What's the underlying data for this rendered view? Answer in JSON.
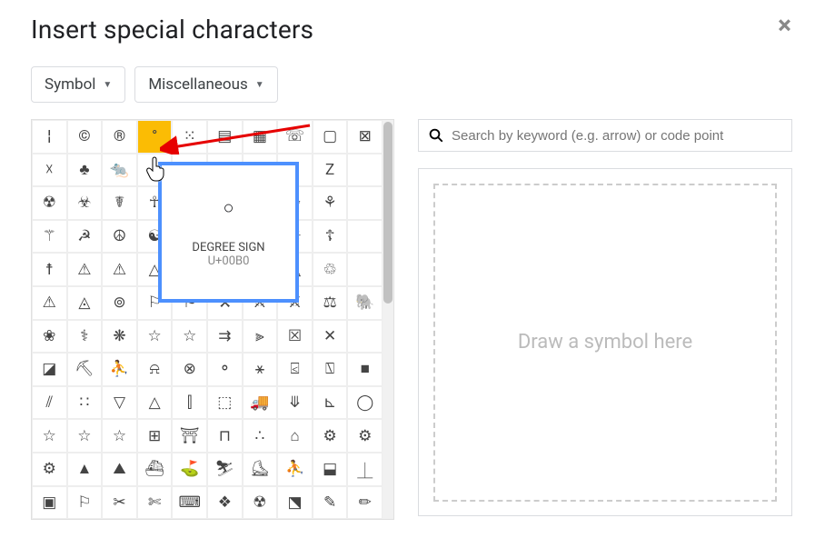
{
  "dialog": {
    "title": "Insert special characters",
    "close": "×"
  },
  "dropdowns": {
    "category": "Symbol",
    "subcategory": "Miscellaneous"
  },
  "search": {
    "placeholder": "Search by keyword (e.g. arrow) or code point"
  },
  "draw": {
    "placeholder": "Draw a symbol here"
  },
  "tooltip": {
    "char": "○",
    "name": "DEGREE SIGN",
    "code": "U+00B0"
  },
  "grid": {
    "rows": [
      [
        "¦",
        "©",
        "®",
        "°",
        "⁙",
        "▤",
        "▦",
        "☏",
        "▢",
        "⊠"
      ],
      [
        "☓",
        "♣",
        "🐀",
        "",
        "",
        "",
        "",
        "🕱",
        "Z",
        " "
      ],
      [
        "☢",
        "☣",
        "☤",
        "☥",
        "",
        "",
        "",
        "☪",
        "⚘",
        " "
      ],
      [
        "⚚",
        "☭",
        "☮",
        "☯",
        "",
        "",
        "",
        "☀",
        "☦",
        " "
      ],
      [
        "☨",
        "⚠",
        "⚠",
        "△",
        "",
        "",
        "",
        "△",
        "♲",
        " "
      ],
      [
        "⚠",
        "◬",
        "⊚",
        "⚐",
        "⚑",
        "⚒",
        "⚔",
        "⚔",
        "⚖",
        "🐘"
      ],
      [
        "❀",
        "⚕",
        "❋",
        "☆",
        "☆",
        "⇉",
        "⫸",
        "☒",
        "✕",
        " "
      ],
      [
        "◪",
        "⛏",
        "⛹",
        "⍾",
        "⊗",
        "⚬",
        "⚹",
        "⍃",
        "⍂",
        "■"
      ],
      [
        "⫽",
        "∷",
        "▽",
        "△",
        "⫿",
        "⬚",
        "🚚",
        "⤋",
        "⊾",
        "◯"
      ],
      [
        "☆",
        "☆",
        "☆",
        "⊞",
        "⛩",
        "⊓",
        "∴",
        "⌂",
        "⚙",
        "⚙"
      ],
      [
        "⚙",
        "▲",
        "⛰",
        "⛴",
        "⛳",
        "⛷",
        "⛸",
        "⛹",
        "⬓",
        "⏊"
      ],
      [
        "▣",
        "⚐",
        "✂",
        "✄",
        "⌨",
        "❖",
        "☢",
        "⬔",
        "✎",
        "✏"
      ]
    ],
    "highlighted": [
      0,
      3
    ]
  }
}
